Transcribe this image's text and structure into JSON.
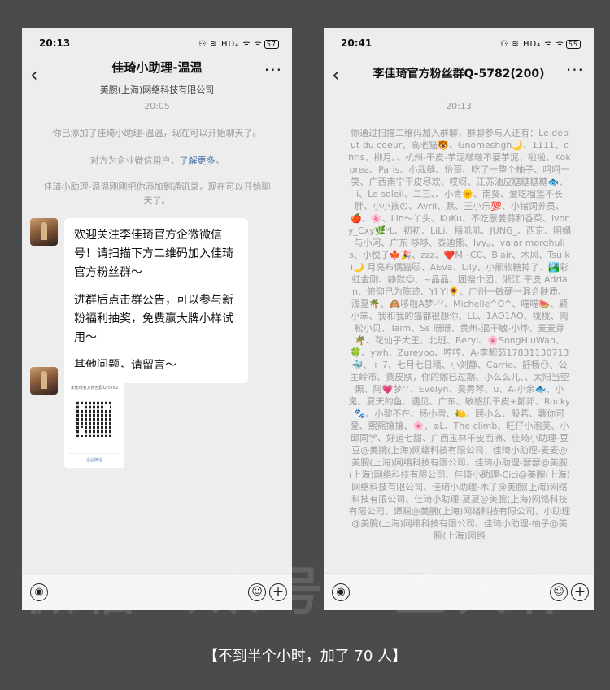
{
  "left_phone": {
    "status_time": "20:13",
    "status_icons": "⚇ ≋ HD₄ ᯤ ᯤ",
    "battery": "57",
    "title": "佳琦小助理-温温",
    "subtitle": "美腕(上海)网络科技有限公司",
    "timestamp": "20:05",
    "sys_added": "你已添加了佳琦小助理-温温，现在可以开始聊天了。",
    "sys_enterprise_prefix": "对方为企业微信用户，",
    "sys_enterprise_link": "了解更多。",
    "sys_contact": "佳琦小助理-温温刚刚把你添加到通讯录，现在可以开始聊天了。",
    "bubble_line1": "欢迎关注李佳琦官方企微微信号！请扫描下方二维码加入佳琦官方粉丝群～",
    "bubble_line2": "进群后点击群公告，可以参与新粉福利抽奖，免费赢大牌小样试用～",
    "bubble_line3": "其他问题，请留言～",
    "qr_title": "李佳琦官方粉丝群Q-5782",
    "qr_footer": "企业微信"
  },
  "right_phone": {
    "status_time": "20:41",
    "status_icons": "⚇ ≋ HD₄ ᯤ ᯤ",
    "battery": "55",
    "title": "李佳琦官方粉丝群Q-5782(200)",
    "timestamp": "20:13",
    "members_text": "你通过扫描二维码加入群聊，群聊参与人还有：Le début du coeur、高老猫🐯、Gnomeshgh🌙、1111、chris、柳月。、杭州-干皮-芋泥啵啵不要芋泥、啦啦、Kokorea、Paris、小栽缝、怡哥、吃了一整个柚子、呵呵一笑、广西南宁干皮尽欢、哎呀、江苏油皮糖糖糖糖🐟、i、Le soleil、二三、、小青🌞、南葵、爱吃榴莲不长胖、小小孩の、Avril、默、王小乐💯、小猪饲养员、🍎、🌸、Lin～丫头、KuKu、不吃葱姜蒜和香菜、ivory_Cxy🌿ᵘL、初初、LiLi、精叽叽、JUNG_、西京、明媚与小河、广东 哆哆、泰迪熊、Ivy。、valar morghulis、小悦子🍁🎉、zzz、❤️M~CC、Blair、木风、Tsu ki🌙 月亮布偶猫🐱、AEva、Lily、小熊软糖掉了、🏞️彩虹金刚、静默😊、~晶晶、团嗖个团、浙江 干皮 Adrian、俯仰已为陈迹、YI YI🌻、广州一敏硬一混合肤质、浅夏🌴、🙈哆啦A梦-ᐟᐟ、Michelle^O^、喵喵🍉、颖小笨、我和我的猫都很想你、LL、1AO1AO、桃桃、肉松小贝、Taim、Ss 珊珊、贵州-混干敏-小烨、麦麦芽🌴、花仙子大王、北斑、Beryl、🌸SongHiuWan、🍀、ywh、Zureyoo、哼哼、A-李靓茹17831130713🐳、+ 7、七月七日晴、小刘静、Carrie、舒畅😶、公主岭市、黄皮肤，你的娜已过期、小么么儿、、太阳当空照、阿💗梦ᐟᐟ、Evelyn、吴秀琴、u、A-小余🐟、小鬼、夏天的鱼、遇见、广东、敏感肌干皮+鄭邦、Rocky🐾、小黎不在、杨小雪、🍋、顾小么、般若、薯你可爱、熙熙攘攘、🌸、ɷL、The climb、旺仔小泡芙、小邱同学、好运七甜、广西玉林干皮西洲、佳琦小助理-豆豆@美腕(上海)网络科技有限公司、佳琦小助理-麦麦@美腕(上海)网络科技有限公司、佳琦小助理-瑟瑟@美腕(上海)网络科技有限公司、佳琦小助理-Cici@美腕(上海)网络科技有限公司、佳琦小助理-木子@美腕(上海)网络科技有限公司、佳琦小助理-夏夏@美腕(上海)网络科技有限公司、谭赐@美腕(上海)网络科技有限公司、小助理@美腕(上海)网络科技有限公司、佳琦小助理-柚子@美腕(上海)网络"
  },
  "watermark": "微信公众号：孟大伟",
  "caption": "【不到半个小时，加了 70 人】"
}
